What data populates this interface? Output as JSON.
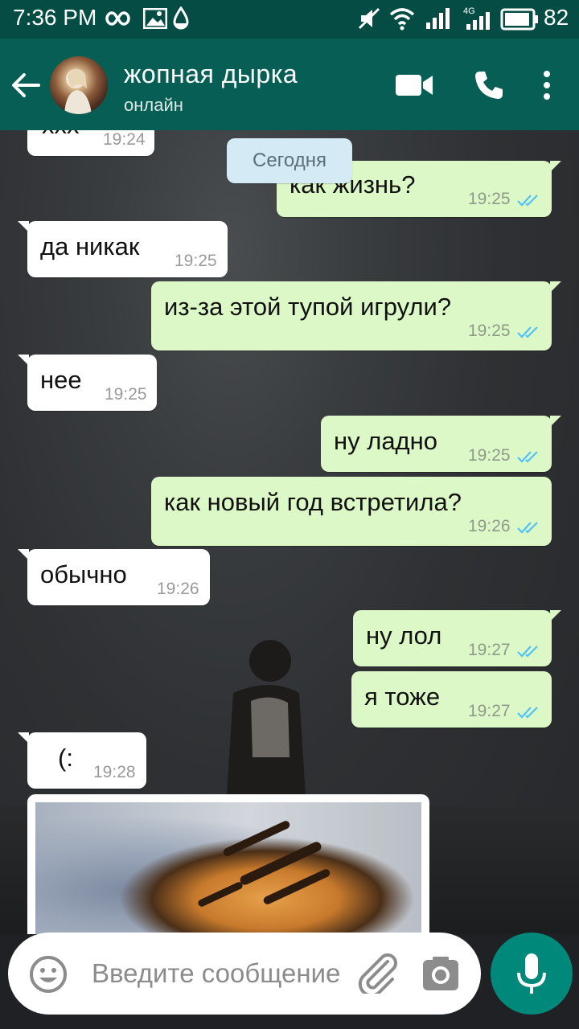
{
  "status_bar": {
    "time": "7:36 PM",
    "battery": "82",
    "net_label": "4G"
  },
  "header": {
    "contact_name": "жопная дырка",
    "status": "онлайн"
  },
  "chat": {
    "date_chip": "Сегодня",
    "partial_message": {
      "text": "ххх",
      "time": "19:24"
    },
    "messages": [
      {
        "dir": "out",
        "text": "как жизнь?",
        "time": "19:25"
      },
      {
        "dir": "in",
        "text": "да никак",
        "time": "19:25"
      },
      {
        "dir": "out",
        "text": "из-за этой тупой игрули?",
        "time": "19:25"
      },
      {
        "dir": "in",
        "text": "нее",
        "time": "19:25"
      },
      {
        "dir": "out",
        "text": "ну ладно",
        "time": "19:25"
      },
      {
        "dir": "out",
        "text": "как новый год встретила?",
        "time": "19:26"
      },
      {
        "dir": "in",
        "text": "обычно",
        "time": "19:26"
      },
      {
        "dir": "out",
        "text": "ну лол",
        "time": "19:27"
      },
      {
        "dir": "out",
        "text": "я тоже",
        "time": "19:27"
      },
      {
        "dir": "in",
        "text": "(:",
        "time": "19:28"
      }
    ]
  },
  "composer": {
    "placeholder": "Введите сообщение"
  },
  "colors": {
    "header": "#075e54",
    "status_bar": "#054d44",
    "outgoing_bubble": "#dcf8c6",
    "incoming_bubble": "#ffffff",
    "read_ticks": "#4fc3f7",
    "mic_button": "#00897b"
  },
  "icons": [
    "back-arrow-icon",
    "video-call-icon",
    "phone-icon",
    "more-vert-icon",
    "emoji-icon",
    "attach-icon",
    "camera-icon",
    "mic-icon",
    "wifi-icon",
    "signal-icon",
    "battery-icon",
    "mute-icon",
    "infinity-icon",
    "gallery-icon",
    "drop-icon"
  ]
}
